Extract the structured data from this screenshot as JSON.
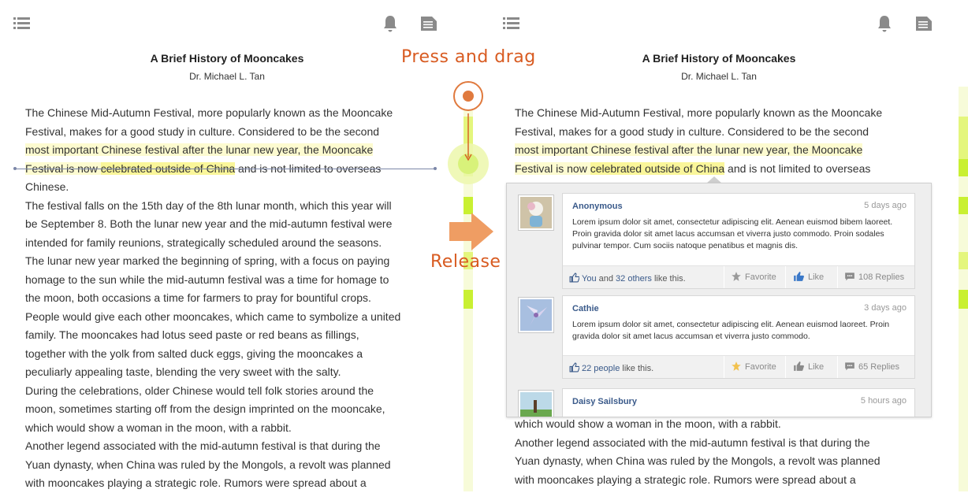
{
  "left": {
    "article": {
      "title": "A Brief History of Mooncakes",
      "author": "Dr. Michael L. Tan",
      "lines": [
        "The Chinese Mid-Autumn Festival, more popularly known as the Mooncake",
        "Festival, makes for a good study in culture. Considered to be the second",
        "most important Chinese festival after the lunar new year, the Mooncake",
        "Festival is now ",
        "celebrated outside of China",
        " and is not limited to overseas",
        "Chinese.",
        "The festival falls on the 15th day of the 8th lunar month, which this year will",
        "be September 8.  Both the lunar new year and the mid-autumn festival were",
        "intended for family reunions, strategically scheduled around the seasons.",
        "The lunar new year marked the beginning of spring, with a focus on paying",
        "homage to the sun while the mid-autumn festival was a time for homage to",
        "the moon, both occasions a time for farmers to pray for bountiful crops.",
        "People would give each other mooncakes, which came to symbolize a united",
        "family.  The mooncakes had lotus seed paste or red beans as fillings,",
        "together with the yolk from salted duck eggs, giving the mooncakes a",
        "peculiarly appealing taste, blending the very sweet with the salty.",
        "During the celebrations, older Chinese would tell folk stories around the",
        "moon, sometimes starting off from the design imprinted on the mooncake,",
        "which would show a woman in the moon, with a rabbit.",
        "Another legend associated with the mid-autumn festival is that during the",
        "Yuan dynasty, when China was ruled by the Mongols, a revolt was planned",
        "with mooncakes playing a strategic role.  Rumors were spread about a"
      ]
    }
  },
  "annotations": {
    "press_and_drag": "Press and drag",
    "release": "Release"
  },
  "right": {
    "article": {
      "title": "A Brief History of Mooncakes",
      "author": "Dr. Michael L. Tan",
      "lines_top": [
        "The Chinese Mid-Autumn Festival, more popularly known as the Mooncake",
        "Festival, makes for a good study in culture. Considered to be the second",
        "most important Chinese festival after the lunar new year, the Mooncake",
        "Festival is now ",
        "celebrated outside of China",
        " and is not limited to overseas"
      ],
      "lines_bottom": [
        "which would show a woman in the moon, with a rabbit.",
        "Another legend associated with the mid-autumn festival is that during the",
        "Yuan dynasty, when China was ruled by the Mongols, a revolt was planned",
        "with mooncakes playing a strategic role.  Rumors were spread about a"
      ]
    },
    "comments": [
      {
        "name": "Anonymous",
        "time": "5 days ago",
        "text": "Lorem ipsum dolor sit amet, consectetur adipiscing elit. Aenean euismod bibem laoreet. Proin gravida dolor sit amet lacus accumsan et viverra justo commodo. Proin sodales pulvinar tempor. Cum sociis natoque penatibus et magnis dis.",
        "likes_you": "You",
        "likes_and": " and ",
        "likes_others": "32 others",
        "likes_suffix": " like this.",
        "favorite": "Favorite",
        "like": "Like",
        "replies": "108 Replies"
      },
      {
        "name": "Cathie",
        "time": "3 days ago",
        "text": "Lorem ipsum dolor sit amet, consectetur adipiscing elit. Aenean euismod laoreet. Proin gravida dolor sit amet lacus accumsan et viverra justo commodo.",
        "likes_people": "22 people",
        "likes_suffix": " like this.",
        "favorite": "Favorite",
        "like": "Like",
        "replies": "65 Replies"
      },
      {
        "name": "Daisy Sailsbury",
        "time": "5 hours ago"
      }
    ]
  },
  "colors": {
    "accent_orange": "#d85b21",
    "highlight": "#faf69a",
    "gutter_green": "#c9f032",
    "link_blue": "#3a5a8a"
  },
  "icons": [
    "menu-icon",
    "bell-icon",
    "document-icon",
    "thumbs-up-icon",
    "star-icon",
    "comment-icon",
    "arrow-right-icon"
  ]
}
